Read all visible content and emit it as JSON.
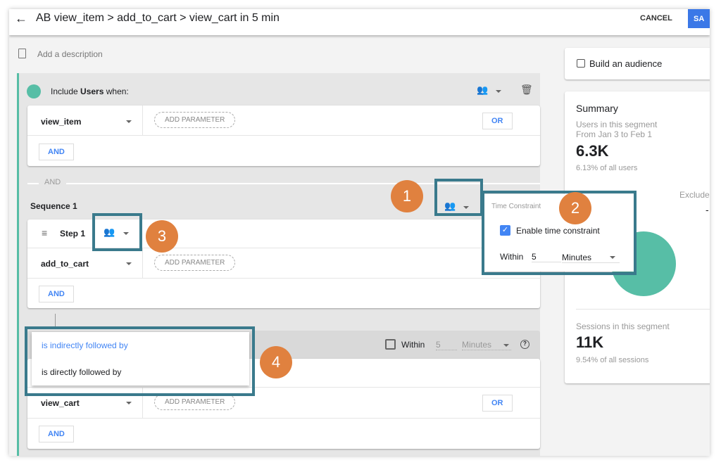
{
  "header": {
    "title": "AB view_item > add_to_cart > view_cart in 5 min",
    "cancel_label": "CANCEL",
    "save_label": "SA"
  },
  "description_placeholder": "Add a description",
  "include": {
    "prefix": "Include ",
    "bold": "Users",
    "suffix": " when:"
  },
  "condition1": {
    "event": "view_item",
    "add_parameter": "ADD PARAMETER",
    "or_label": "OR",
    "and_label": "AND"
  },
  "and_divider": "AND",
  "sequence": {
    "title": "Sequence 1",
    "step1": {
      "label": "Step 1",
      "event": "add_to_cart",
      "add_parameter": "ADD PARAMETER",
      "and_label": "AND"
    },
    "step2": {
      "within_label": "Within",
      "within_value": "5",
      "unit": "Minutes",
      "help": "?",
      "event": "view_cart",
      "add_parameter": "ADD PARAMETER",
      "or_label": "OR",
      "and_label": "AND"
    }
  },
  "follow_menu": {
    "options": [
      "is indirectly followed by",
      "is directly followed by"
    ],
    "selected": 0
  },
  "time_constraint": {
    "title": "Time Constraint",
    "enable_label": "Enable time constraint",
    "enabled": true,
    "within_label": "Within",
    "value": "5",
    "unit": "Minutes"
  },
  "audience": {
    "label": "Build an audience",
    "checked": false
  },
  "summary": {
    "title": "Summary",
    "users_label": "Users in this segment",
    "date_range": "From Jan 3 to Feb 1",
    "users_value": "6.3K",
    "users_pct": "6.13% of all users",
    "excluded_label": "Exclude",
    "excluded_value": "-",
    "sessions_label": "Sessions in this segment",
    "sessions_value": "11K",
    "sessions_pct": "9.54% of all sessions"
  },
  "callouts": [
    "1",
    "2",
    "3",
    "4"
  ],
  "colors": {
    "accent": "#4285f4",
    "segment": "#57bea6",
    "callout": "#e0813f",
    "highlight": "#3a7a8c"
  }
}
